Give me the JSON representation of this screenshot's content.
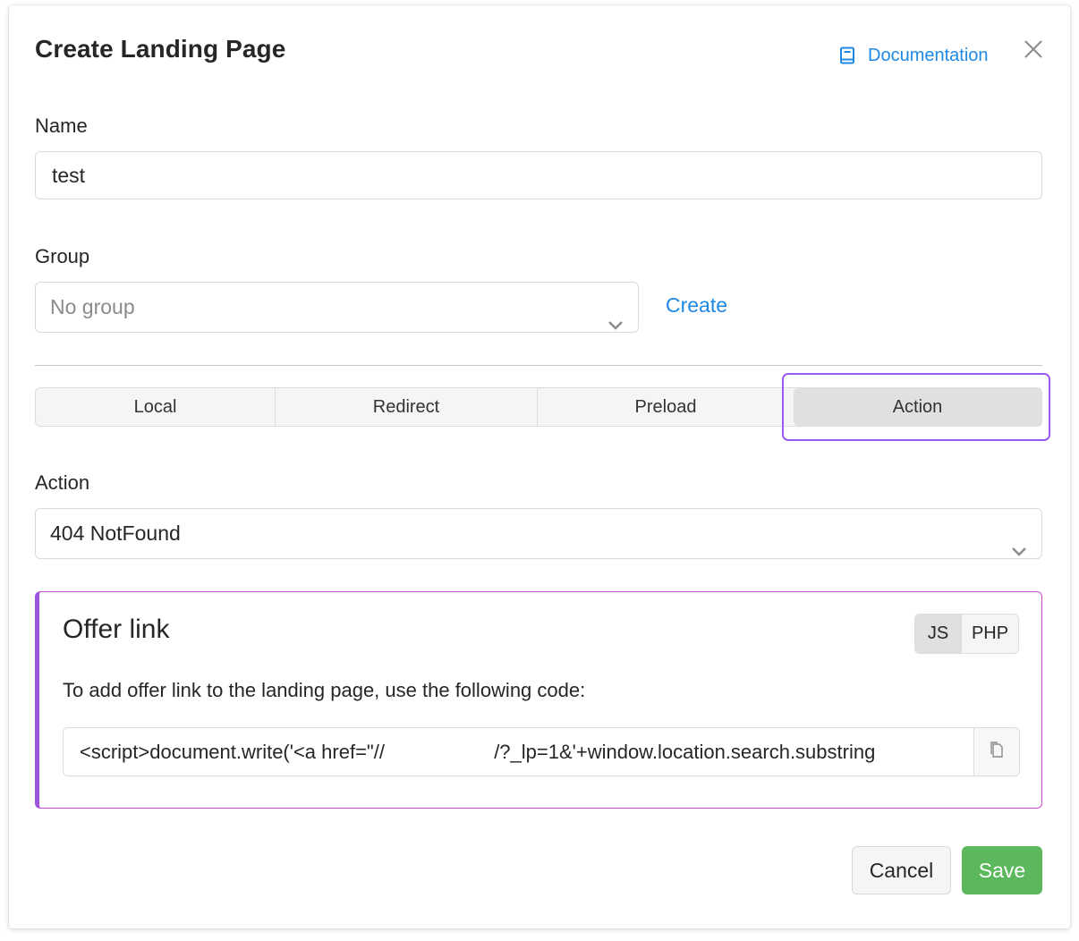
{
  "dialog": {
    "title": "Create Landing Page",
    "documentation_label": "Documentation"
  },
  "name_field": {
    "label": "Name",
    "value": "test"
  },
  "group_field": {
    "label": "Group",
    "value": "No group",
    "create_label": "Create"
  },
  "type_tabs": [
    {
      "label": "Local",
      "active": false
    },
    {
      "label": "Redirect",
      "active": false
    },
    {
      "label": "Preload",
      "active": false
    },
    {
      "label": "Action",
      "active": true
    }
  ],
  "action_field": {
    "label": "Action",
    "value": "404 NotFound"
  },
  "offer_link": {
    "title": "Offer link",
    "lang_options": [
      "JS",
      "PHP"
    ],
    "selected_lang": "JS",
    "description": "To add offer link to the landing page, use the following code:",
    "code": "<script>document.write('<a href=\"//                    /?_lp=1&'+window.location.search.substring"
  },
  "footer": {
    "cancel_label": "Cancel",
    "save_label": "Save"
  },
  "colors": {
    "link": "#1e88e5",
    "save": "#5cb85c",
    "accent_purple": "#9b56e0"
  },
  "icons": {
    "documentation": "book-icon",
    "close": "close-icon",
    "dropdown": "chevron-down-icon",
    "copy": "copy-icon"
  }
}
